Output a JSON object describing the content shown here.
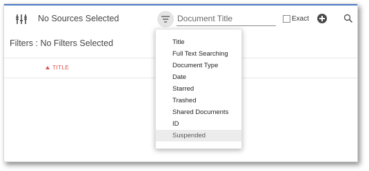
{
  "toolbar": {
    "sources_label": "No Sources Selected",
    "search_placeholder": "Document Title",
    "exact_label": "Exact"
  },
  "filters": {
    "label": "Filters : No Filters Selected"
  },
  "grid": {
    "sorted_column": "TITLE"
  },
  "dropdown": {
    "items": [
      "Title",
      "Full Text Searching",
      "Document Type",
      "Date",
      "Starred",
      "Trashed",
      "Shared Documents",
      "ID",
      "Suspended"
    ],
    "selected_item": "Suspended"
  },
  "colors": {
    "accent": "#4a78c2",
    "sort_red": "#d9534f"
  }
}
